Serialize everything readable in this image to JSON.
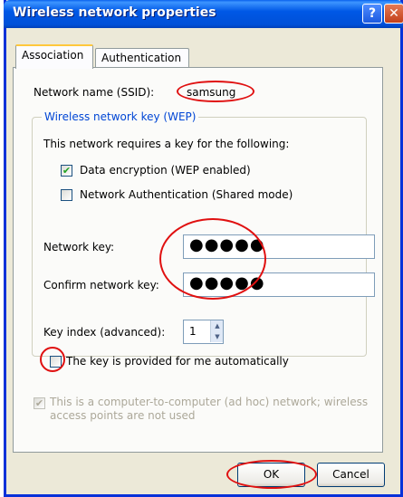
{
  "window": {
    "title": "Wireless network properties",
    "help_glyph": "?",
    "close_glyph": "✕"
  },
  "tabs": [
    {
      "label": "Association",
      "active": true
    },
    {
      "label": "Authentication",
      "active": false
    }
  ],
  "association": {
    "ssid_label": "Network name (SSID):",
    "ssid_value": "samsung",
    "group_title": "Wireless network key (WEP)",
    "requires_text": "This network requires a key for the following:",
    "data_encryption": {
      "label": "Data encryption (WEP enabled)",
      "checked": true
    },
    "network_auth": {
      "label": "Network Authentication (Shared mode)",
      "checked": false
    },
    "network_key_label": "Network key:",
    "network_key_value": "●●●●●",
    "confirm_key_label": "Confirm network key:",
    "confirm_key_value": "●●●●●",
    "key_index_label": "Key index (advanced):",
    "key_index_value": "1",
    "auto_key": {
      "label": "The key is provided for me automatically",
      "checked": false
    },
    "adhoc_line1": "This is a computer-to-computer (ad hoc) network; wireless",
    "adhoc_line2": "access points are not used",
    "adhoc_checked": true
  },
  "buttons": {
    "ok": "OK",
    "cancel": "Cancel"
  },
  "colors": {
    "titlebar": "#0058e6",
    "annotation_ring": "#e01010",
    "group_title": "#0046d5"
  }
}
